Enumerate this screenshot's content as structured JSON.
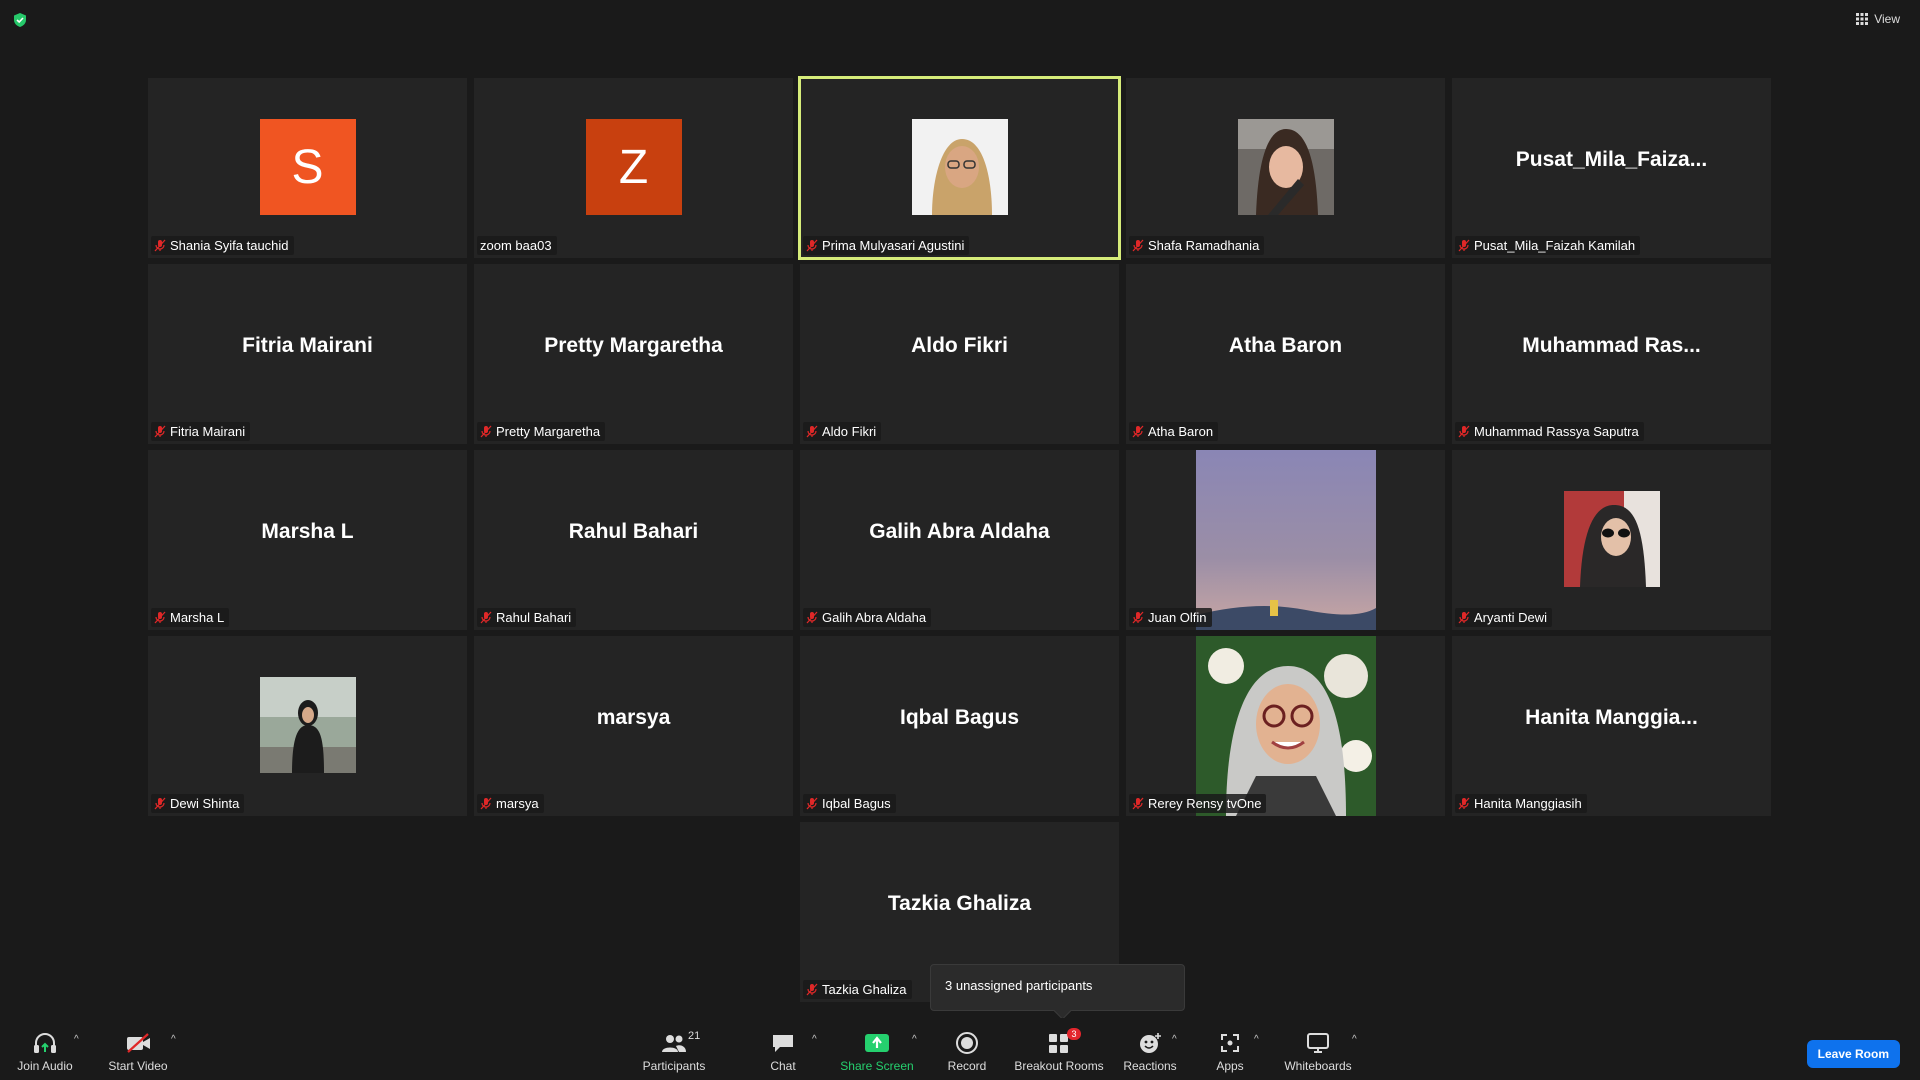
{
  "top": {
    "view_label": "View"
  },
  "tiles": [
    {
      "name": "Shania Syifa tauchid",
      "type": "letter",
      "letter": "S",
      "color": "#f05522",
      "muted": true
    },
    {
      "name": "zoom baa03",
      "type": "letter",
      "letter": "Z",
      "color": "#c8400f",
      "muted": false
    },
    {
      "name": "Prima Mulyasari Agustini",
      "type": "photo",
      "photo": "woman-hijab-glasses",
      "muted": true,
      "active": true
    },
    {
      "name": "Shafa Ramadhania",
      "type": "photo",
      "photo": "woman-selfie-car",
      "muted": true
    },
    {
      "name": "Pusat_Mila_Faizah Kamilah",
      "type": "text",
      "display": "Pusat_Mila_Faiza...",
      "muted": true
    },
    {
      "name": "Fitria Mairani",
      "type": "text",
      "display": "Fitria Mairani",
      "muted": true
    },
    {
      "name": "Pretty Margaretha",
      "type": "text",
      "display": "Pretty Margaretha",
      "muted": true
    },
    {
      "name": "Aldo Fikri",
      "type": "text",
      "display": "Aldo Fikri",
      "muted": true
    },
    {
      "name": "Atha Baron",
      "type": "text",
      "display": "Atha Baron",
      "muted": true
    },
    {
      "name": "Muhammad Rassya Saputra",
      "type": "text",
      "display": "Muhammad  Ras...",
      "muted": true
    },
    {
      "name": "Marsha L",
      "type": "text",
      "display": "Marsha L",
      "muted": true
    },
    {
      "name": "Rahul Bahari",
      "type": "text",
      "display": "Rahul Bahari",
      "muted": true
    },
    {
      "name": "Galih Abra Aldaha",
      "type": "text",
      "display": "Galih Abra Aldaha",
      "muted": true
    },
    {
      "name": "Juan Olfin",
      "type": "video",
      "photo": "sunset-sky",
      "muted": true
    },
    {
      "name": "Aryanti Dewi",
      "type": "photo",
      "photo": "woman-sunglasses",
      "muted": true
    },
    {
      "name": "Dewi Shinta",
      "type": "photo",
      "photo": "woman-outdoor",
      "muted": true
    },
    {
      "name": "marsya",
      "type": "text",
      "display": "marsya",
      "muted": true
    },
    {
      "name": "Iqbal Bagus",
      "type": "text",
      "display": "Iqbal Bagus",
      "muted": true
    },
    {
      "name": "Rerey Rensy tvOne",
      "type": "video",
      "photo": "woman-hijab-flowers",
      "muted": true
    },
    {
      "name": "Hanita Manggiasih",
      "type": "text",
      "display": "Hanita  Manggia...",
      "muted": true
    },
    {
      "name": "Tazkia Ghaliza",
      "type": "text",
      "display": "Tazkia Ghaliza",
      "muted": true
    }
  ],
  "tooltip": {
    "text": "3 unassigned participants"
  },
  "toolbar": {
    "join_audio": "Join Audio",
    "start_video": "Start Video",
    "participants": "Participants",
    "participants_count": "21",
    "chat": "Chat",
    "share_screen": "Share Screen",
    "record": "Record",
    "breakout_rooms": "Breakout Rooms",
    "breakout_badge": "3",
    "reactions": "Reactions",
    "apps": "Apps",
    "whiteboards": "Whiteboards",
    "leave_room": "Leave Room"
  },
  "colors": {
    "active_border": "#d6ec7a",
    "share_green": "#25d06e",
    "leave_blue": "#0e72ed",
    "mute_red": "#e02828"
  }
}
